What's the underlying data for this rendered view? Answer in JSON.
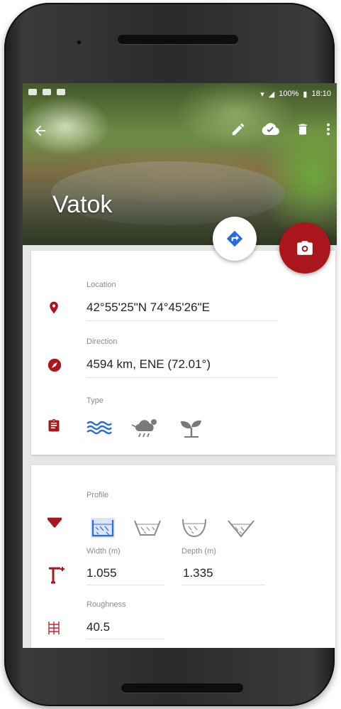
{
  "place": {
    "title": "Vatok"
  },
  "status_bar": {
    "battery": "100%",
    "time": "18:10"
  },
  "fields": {
    "location": {
      "label": "Location",
      "value": "42°55'25\"N 74°45'26\"E"
    },
    "direction": {
      "label": "Direction",
      "value": "4594 km, ENE (72.01°)"
    },
    "type": {
      "label": "Type",
      "options": [
        "river-waves-icon",
        "cloud-rain-icon",
        "plant-icon"
      ],
      "selected": 0
    }
  },
  "hydraulics": {
    "profile": {
      "label": "Profile",
      "options": [
        "profile-rectangle-icon",
        "profile-trapezoid-icon",
        "profile-u-icon",
        "profile-triangle-icon"
      ],
      "selected": 0
    },
    "width": {
      "label": "Width (m)",
      "value": "1.055"
    },
    "depth": {
      "label": "Depth (m)",
      "value": "1.335"
    },
    "roughness": {
      "label": "Roughness",
      "value": "40.5"
    }
  },
  "colors": {
    "accent": "#a9161b",
    "selection": "#2a6ae0",
    "icon_gray": "#7a7a7a"
  }
}
